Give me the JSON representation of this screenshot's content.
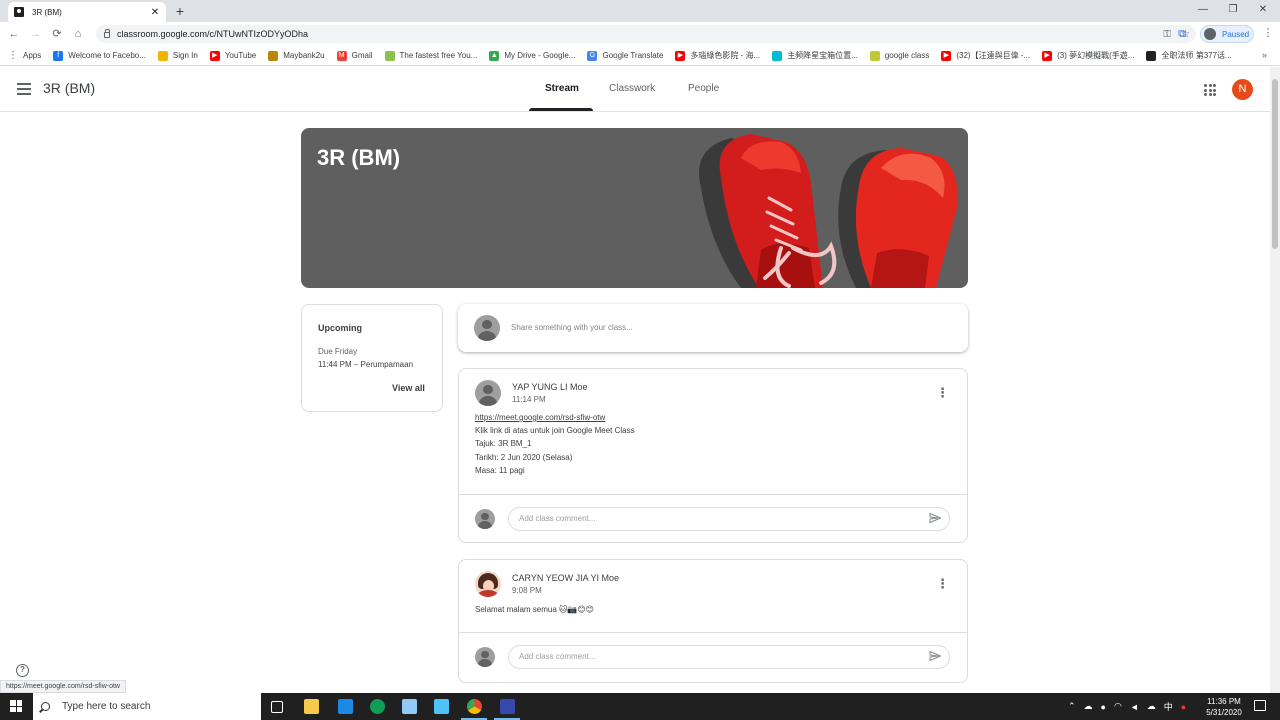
{
  "browser": {
    "tab_title": "3R (BM)",
    "tab_close": "✕",
    "new_tab": "+",
    "url": "classroom.google.com/c/NTUwNTIzODYyODha",
    "profile_status": "Paused",
    "window_controls": [
      "—",
      "❐",
      "✕"
    ],
    "nav": {
      "back": "←",
      "forward": "→",
      "reload": "⟳",
      "home": "⌂"
    },
    "menu": "⋮"
  },
  "bookmarks": [
    {
      "label": "Apps",
      "color": "#5f6368",
      "glyph": "⋮"
    },
    {
      "label": "Welcome to Facebo...",
      "color": "#1877f2",
      "glyph": "f"
    },
    {
      "label": "Sign In",
      "color": "#f4b400",
      "glyph": ""
    },
    {
      "label": "YouTube",
      "color": "#ff0000",
      "glyph": "▶"
    },
    {
      "label": "Maybank2u",
      "color": "#b8860b",
      "glyph": ""
    },
    {
      "label": "Gmail",
      "color": "#ea4335",
      "glyph": "M"
    },
    {
      "label": "The fastest free You...",
      "color": "#8bc34a",
      "glyph": ""
    },
    {
      "label": "My Drive - Google...",
      "color": "#34a853",
      "glyph": "▲"
    },
    {
      "label": "Google Translate",
      "color": "#4285f4",
      "glyph": "G"
    },
    {
      "label": "多瑙綠色影院 - 海...",
      "color": "#ff0000",
      "glyph": "▶"
    },
    {
      "label": "主频降星宝箱位置...",
      "color": "#00bcd4",
      "glyph": ""
    },
    {
      "label": "google class",
      "color": "#c0ca33",
      "glyph": ""
    },
    {
      "label": "(32)【汪遠與巨偉 -...",
      "color": "#ff0000",
      "glyph": "▶"
    },
    {
      "label": "(3) 夢幻模擬戰(手遊...",
      "color": "#ff0000",
      "glyph": "▶"
    },
    {
      "label": "全职法师 第377话...",
      "color": "#212121",
      "glyph": ""
    }
  ],
  "bookmarks_more": "»",
  "header": {
    "class_name": "3R (BM)",
    "tabs": [
      "Stream",
      "Classwork",
      "People"
    ],
    "user_initial": "N"
  },
  "banner": {
    "title": "3R (BM)"
  },
  "upcoming": {
    "title": "Upcoming",
    "due": "Due Friday",
    "item": "11:44 PM – Perumpamaan",
    "view_all": "View all"
  },
  "share": {
    "placeholder": "Share something with your class..."
  },
  "posts": [
    {
      "author": "YAP YUNG LI Moe",
      "time": "11:14 PM",
      "link": "https://meet.google.com/rsd-sfiw-otw",
      "lines": [
        "Klik link di atas untuk join Google Meet Class",
        "Tajuk: 3R BM_1",
        "Tarikh: 2 Jun 2020 (Selasa)",
        "Masa: 11 pagi"
      ],
      "comment_placeholder": "Add class comment..."
    },
    {
      "author": "CARYN YEOW JIA YI Moe",
      "time": "9:08 PM",
      "text": "Selamat malam semua 🐱📷😊😊",
      "comment_placeholder": "Add class comment..."
    }
  ],
  "more_icon": "⋮",
  "help_icon": "?",
  "status_bar_url": "https://meet.google.com/rsd-sfiw-otw",
  "taskbar": {
    "search_placeholder": "Type here to search",
    "time": "11:36 PM",
    "date": "5/31/2020",
    "ime": "中"
  }
}
